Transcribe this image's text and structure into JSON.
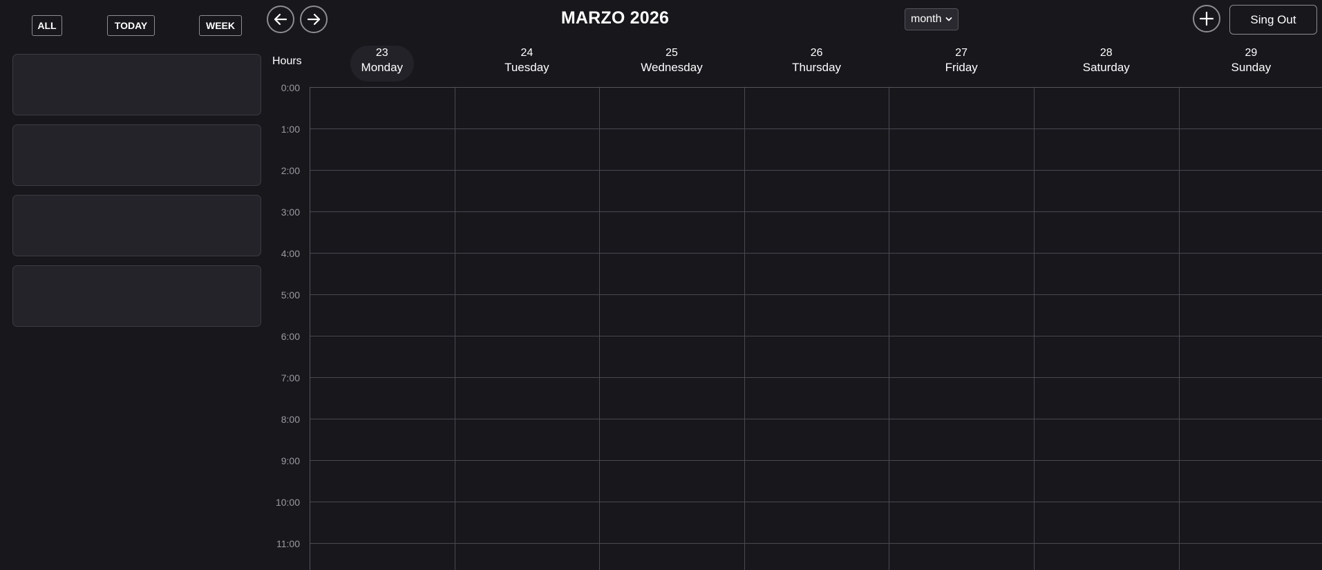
{
  "sidebar": {
    "filters": [
      {
        "label": "ALL"
      },
      {
        "label": "TODAY"
      },
      {
        "label": "WEEK"
      }
    ],
    "cards": [
      {},
      {},
      {},
      {}
    ]
  },
  "header": {
    "title": "MARZO 2026",
    "prev_icon": "arrow-left-icon",
    "next_icon": "arrow-right-icon",
    "view_select": {
      "selected": "month"
    },
    "add_icon": "plus-icon",
    "signout_label": "Sing Out"
  },
  "calendar": {
    "hours_label": "Hours",
    "days": [
      {
        "num": "23",
        "name": "Monday",
        "today": true
      },
      {
        "num": "24",
        "name": "Tuesday"
      },
      {
        "num": "25",
        "name": "Wednesday"
      },
      {
        "num": "26",
        "name": "Thursday"
      },
      {
        "num": "27",
        "name": "Friday"
      },
      {
        "num": "28",
        "name": "Saturday"
      },
      {
        "num": "29",
        "name": "Sunday"
      }
    ],
    "hours": [
      "0:00",
      "1:00",
      "2:00",
      "3:00",
      "4:00",
      "5:00",
      "6:00",
      "7:00",
      "8:00",
      "9:00",
      "10:00",
      "11:00"
    ]
  },
  "colors": {
    "background": "#18171c",
    "card": "#242329",
    "border": "#8d8d92",
    "grid_line": "#4a4950",
    "hour_text": "#9a9aa0",
    "text": "#ffffff"
  }
}
